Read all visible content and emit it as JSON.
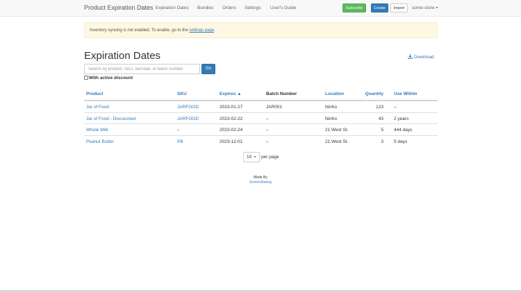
{
  "navbar": {
    "brand": "Product Expiration Dates",
    "links": [
      "Expiration Dates",
      "Bundles",
      "Orders",
      "Settings",
      "User's Guide"
    ],
    "subscribe": "Subscribe",
    "create": "Create",
    "import": "Import",
    "store": "some-store"
  },
  "alert": {
    "text": "Inventory syncing is not enabled. To enable, go to the ",
    "link": "settings page",
    "end": "."
  },
  "page": {
    "title": "Expiration Dates",
    "download": "Download"
  },
  "search": {
    "placeholder": "Search by product, SKU, barcode, or batch number",
    "value": "",
    "go": "Go",
    "discount_label": "With active discount"
  },
  "table": {
    "headers": {
      "product": "Product",
      "sku": "SKU",
      "expires": "Expires ▲",
      "batch": "Batch Number",
      "location": "Location",
      "quantity": "Quantity",
      "use_within": "Use Within"
    },
    "rows": [
      {
        "product": "Jar of Food",
        "sku": "JARFOOD",
        "expires": "2023-01-27",
        "batch": "JAR001",
        "location": "Ninho",
        "quantity": "123",
        "use_within": "–"
      },
      {
        "product": "Jar of Food - Discounted",
        "sku": "JARFOOD",
        "expires": "2023-02-22",
        "batch": "–",
        "location": "Ninho",
        "quantity": "43",
        "use_within": "2 years"
      },
      {
        "product": "Whole Milk",
        "sku": "–",
        "expires": "2023-02-24",
        "batch": "–",
        "location": "21 West St.",
        "quantity": "5",
        "use_within": "444 days"
      },
      {
        "product": "Peanut Butter",
        "sku": "PB",
        "expires": "2023-12-01",
        "batch": "–",
        "location": "21 West St.",
        "quantity": "3",
        "use_within": "5 days"
      }
    ]
  },
  "pagination": {
    "per_page_value": "10",
    "per_page_label": "per page"
  },
  "footer": {
    "made_by": "Made By",
    "company": "ScreenStaring"
  },
  "colors": {
    "link": "#337ab7",
    "subscribe": "#5cb85c",
    "alert_bg": "#fcf8e3"
  }
}
